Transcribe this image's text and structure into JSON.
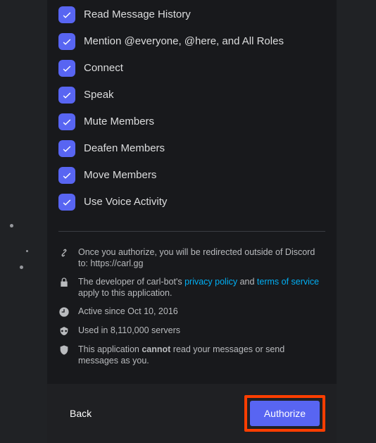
{
  "permissions": [
    {
      "label": "Read Message History"
    },
    {
      "label": "Mention @everyone, @here, and All Roles"
    },
    {
      "label": "Connect"
    },
    {
      "label": "Speak"
    },
    {
      "label": "Mute Members"
    },
    {
      "label": "Deafen Members"
    },
    {
      "label": "Move Members"
    },
    {
      "label": "Use Voice Activity"
    }
  ],
  "info": {
    "redirect_prefix": "Once you authorize, you will be redirected outside of Discord to: ",
    "redirect_url": "https://carl.gg",
    "dev_prefix": "The developer of carl-bot's ",
    "privacy": "privacy policy",
    "and": " and ",
    "tos": "terms of service",
    "dev_suffix": " apply to this application.",
    "active": "Active since Oct 10, 2016",
    "servers": "Used in 8,110,000 servers",
    "shield_a": "This application ",
    "shield_strong": "cannot",
    "shield_b": " read your messages or send messages as you."
  },
  "footer": {
    "back": "Back",
    "authorize": "Authorize"
  }
}
